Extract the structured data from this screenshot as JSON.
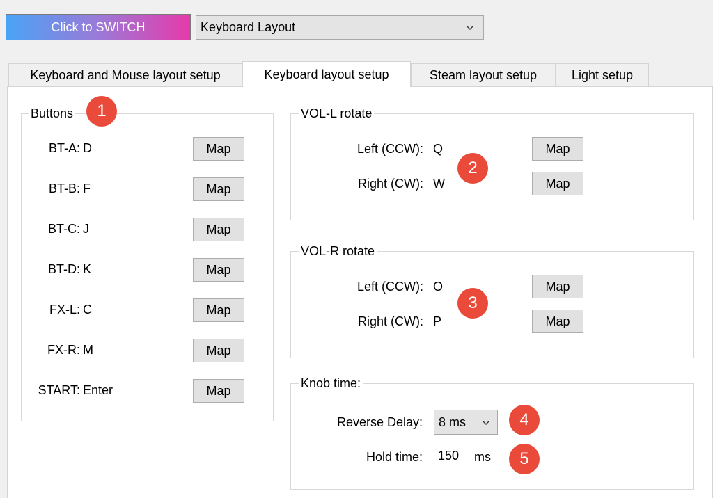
{
  "top": {
    "switch_label": "Click to SWITCH",
    "layout_select": "Keyboard Layout"
  },
  "tabs": [
    {
      "label": "Keyboard and Mouse layout setup"
    },
    {
      "label": "Keyboard layout setup"
    },
    {
      "label": "Steam layout setup"
    },
    {
      "label": "Light setup"
    }
  ],
  "active_tab": "Keyboard layout setup",
  "buttons_group": {
    "title": "Buttons",
    "rows": [
      {
        "label": "BT-A:",
        "key": "D"
      },
      {
        "label": "BT-B:",
        "key": "F"
      },
      {
        "label": "BT-C:",
        "key": "J"
      },
      {
        "label": "BT-D:",
        "key": "K"
      },
      {
        "label": "FX-L:",
        "key": "C"
      },
      {
        "label": "FX-R:",
        "key": "M"
      },
      {
        "label": "START:",
        "key": "Enter"
      }
    ]
  },
  "map_label": "Map",
  "vol_l": {
    "title": "VOL-L rotate",
    "left_label": "Left (CCW):",
    "left_key": "Q",
    "right_label": "Right (CW):",
    "right_key": "W"
  },
  "vol_r": {
    "title": "VOL-R rotate",
    "left_label": "Left (CCW):",
    "left_key": "O",
    "right_label": "Right (CW):",
    "right_key": "P"
  },
  "knob": {
    "title": "Knob time:",
    "reverse_label": "Reverse Delay:",
    "reverse_value": "8 ms",
    "hold_label": "Hold time:",
    "hold_value": "150",
    "hold_unit": "ms"
  },
  "badges": [
    "1",
    "2",
    "3",
    "4",
    "5"
  ],
  "colors": {
    "badge": "#ea4a3a",
    "switch_gradient": [
      "#4aa3f5",
      "#e63aa9"
    ]
  }
}
